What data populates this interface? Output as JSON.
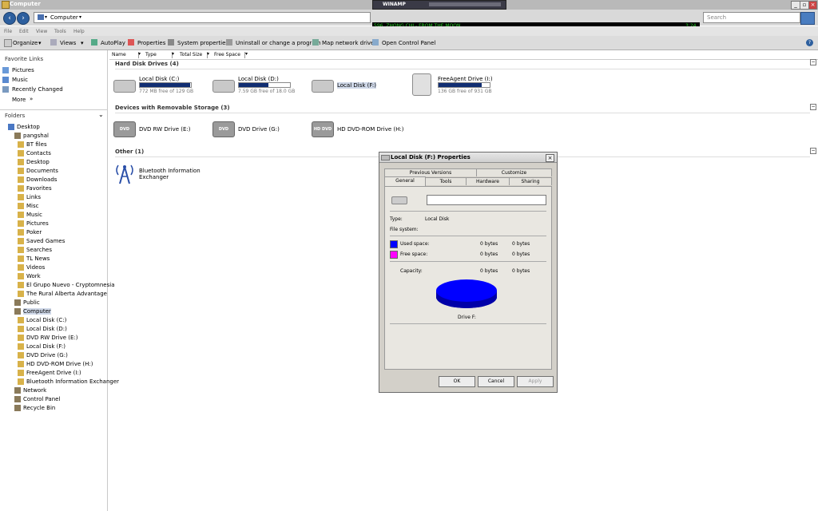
{
  "window": {
    "title": "Computer"
  },
  "winamp": {
    "label": "WINAMP",
    "track": "596. ZHONG CHI - FROM THE MOON",
    "time": "3:24"
  },
  "address": {
    "path": "Computer",
    "search_placeholder": "Search"
  },
  "menu": [
    "File",
    "Edit",
    "View",
    "Tools",
    "Help"
  ],
  "toolbar": [
    "Organize",
    "Views",
    "AutoPlay",
    "Properties",
    "System properties",
    "Uninstall or change a program",
    "Map network drive",
    "Open Control Panel"
  ],
  "left": {
    "favorites_title": "Favorite Links",
    "favorites": [
      "Pictures",
      "Music",
      "Recently Changed"
    ],
    "more": "More",
    "folders_title": "Folders",
    "tree": [
      {
        "label": "Desktop",
        "level": 0
      },
      {
        "label": "pangshal",
        "level": 1
      },
      {
        "label": "BT files",
        "level": 2
      },
      {
        "label": "Contacts",
        "level": 2
      },
      {
        "label": "Desktop",
        "level": 2
      },
      {
        "label": "Documents",
        "level": 2
      },
      {
        "label": "Downloads",
        "level": 2
      },
      {
        "label": "Favorites",
        "level": 2
      },
      {
        "label": "Links",
        "level": 2
      },
      {
        "label": "Misc",
        "level": 2
      },
      {
        "label": "Music",
        "level": 2
      },
      {
        "label": "Pictures",
        "level": 2
      },
      {
        "label": "Poker",
        "level": 2
      },
      {
        "label": "Saved Games",
        "level": 2
      },
      {
        "label": "Searches",
        "level": 2
      },
      {
        "label": "TL News",
        "level": 2
      },
      {
        "label": "Videos",
        "level": 2
      },
      {
        "label": "Work",
        "level": 2
      },
      {
        "label": "El Grupo Nuevo - Cryptomnesia",
        "level": 2
      },
      {
        "label": "The Rural Alberta Advantage",
        "level": 2
      },
      {
        "label": "Public",
        "level": 1
      },
      {
        "label": "Computer",
        "level": 1
      },
      {
        "label": "Local Disk (C:)",
        "level": 2
      },
      {
        "label": "Local Disk (D:)",
        "level": 2
      },
      {
        "label": "DVD RW Drive (E:)",
        "level": 2
      },
      {
        "label": "Local Disk (F:)",
        "level": 2
      },
      {
        "label": "DVD Drive (G:)",
        "level": 2
      },
      {
        "label": "HD DVD-ROM Drive (H:)",
        "level": 2
      },
      {
        "label": "FreeAgent Drive (I:)",
        "level": 2
      },
      {
        "label": "Bluetooth Information Exchanger",
        "level": 2
      },
      {
        "label": "Network",
        "level": 1
      },
      {
        "label": "Control Panel",
        "level": 1
      },
      {
        "label": "Recycle Bin",
        "level": 1
      }
    ]
  },
  "columns": [
    "Name",
    "Type",
    "Total Size",
    "Free Space"
  ],
  "groups": {
    "hdd_title": "Hard Disk Drives (4)",
    "removable_title": "Devices with Removable Storage (3)",
    "other_title": "Other (1)"
  },
  "drives": [
    {
      "name": "Local Disk (C:)",
      "free": "772 MB free of 129 GB",
      "used_fraction": 0.99
    },
    {
      "name": "Local Disk (D:)",
      "free": "7.59 GB free of 18.0 GB",
      "used_fraction": 0.58
    },
    {
      "name": "Local Disk (F:)",
      "free": "",
      "used_fraction": null
    },
    {
      "name": "FreeAgent Drive (I:)",
      "free": "136 GB free of 931 GB",
      "used_fraction": 0.85
    }
  ],
  "removable": [
    {
      "name": "DVD RW Drive (E:)",
      "badge": "DVD"
    },
    {
      "name": "DVD Drive (G:)",
      "badge": "DVD"
    },
    {
      "name": "HD DVD-ROM Drive (H:)",
      "badge": "HD DVD"
    }
  ],
  "other": {
    "name1": "Bluetooth Information",
    "name2": "Exchanger"
  },
  "dialog": {
    "title": "Local Disk (F:) Properties",
    "tabs_row1": [
      "Previous Versions",
      "Customize"
    ],
    "tabs_row2": [
      "General",
      "Tools",
      "Hardware",
      "Sharing"
    ],
    "type_label": "Type:",
    "type_value": "Local Disk",
    "fs_label": "File system:",
    "used_label": "Used space:",
    "used_bytes": "0 bytes",
    "used_size": "0 bytes",
    "free_label": "Free space:",
    "free_bytes": "0 bytes",
    "free_size": "0 bytes",
    "cap_label": "Capacity:",
    "cap_bytes": "0 bytes",
    "cap_size": "0 bytes",
    "drive_label": "Drive F:",
    "ok": "OK",
    "cancel": "Cancel",
    "apply": "Apply",
    "used_color": "#0000ff",
    "free_color": "#ff00ff"
  }
}
